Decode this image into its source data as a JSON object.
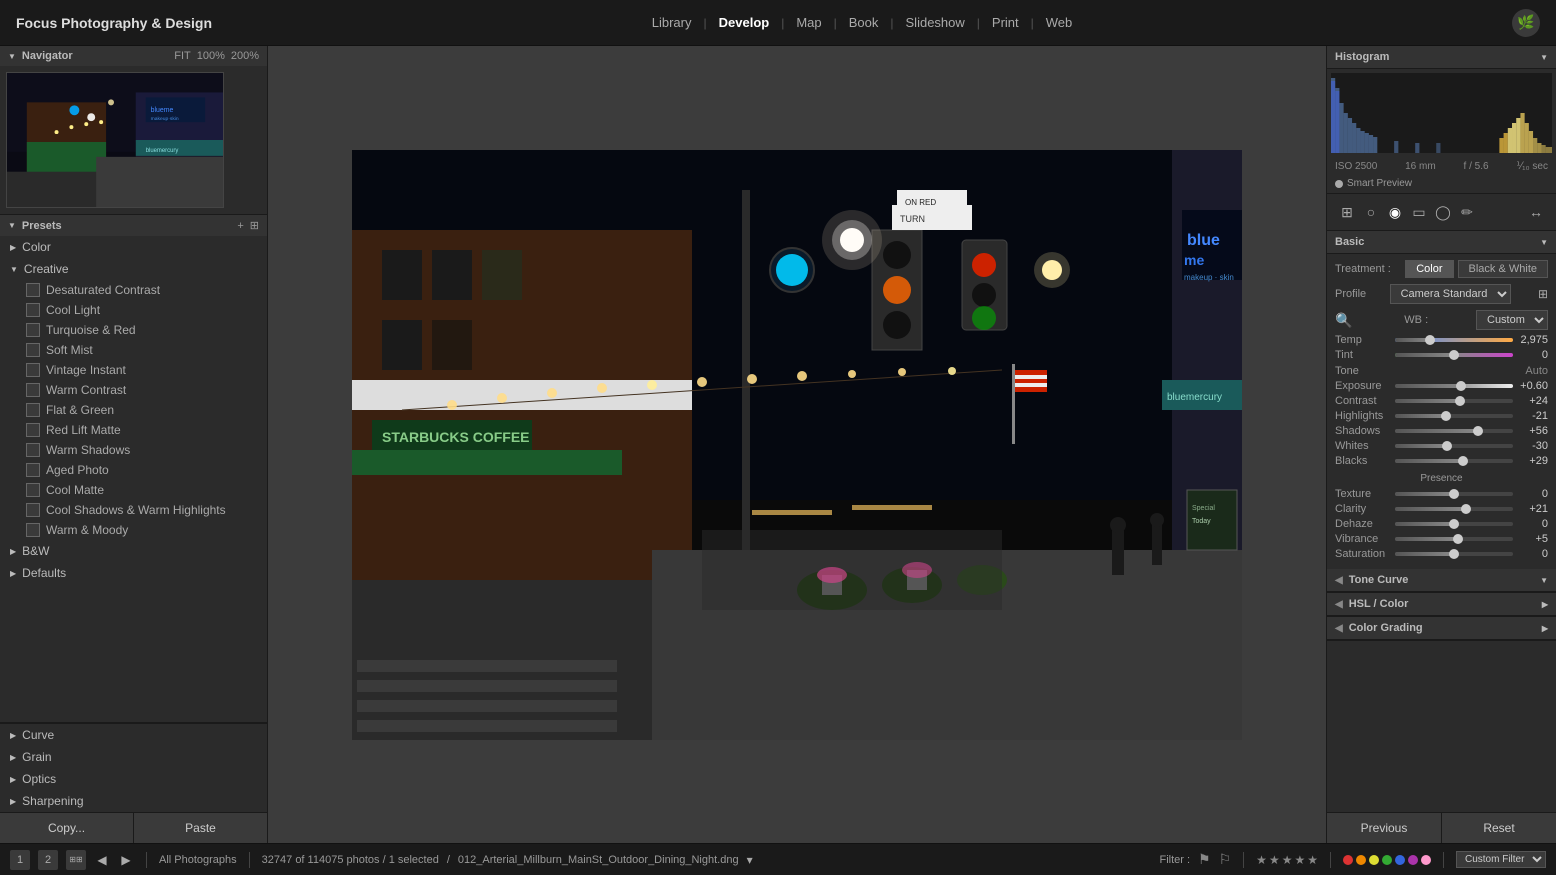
{
  "app": {
    "title": "Focus Photography & Design"
  },
  "nav": {
    "links": [
      "Library",
      "Develop",
      "Map",
      "Book",
      "Slideshow",
      "Print",
      "Web"
    ],
    "active": "Develop"
  },
  "navigator": {
    "label": "Navigator",
    "fit": "FIT",
    "zoom1": "100%",
    "zoom2": "200%"
  },
  "presets": {
    "label": "Presets",
    "sections": [
      {
        "name": "Color",
        "expanded": false,
        "items": []
      },
      {
        "name": "Creative",
        "expanded": true,
        "items": [
          "Desaturated Contrast",
          "Cool Light",
          "Turquoise & Red",
          "Soft Mist",
          "Vintage Instant",
          "Warm Contrast",
          "Flat & Green",
          "Red Lift Matte",
          "Warm Shadows",
          "Aged Photo",
          "Cool Matte",
          "Cool Shadows & Warm Highlights",
          "Warm & Moody"
        ]
      },
      {
        "name": "B&W",
        "expanded": false,
        "items": []
      },
      {
        "name": "Defaults",
        "expanded": false,
        "items": []
      }
    ]
  },
  "left_bottom": {
    "sections": [
      "Curve",
      "Grain",
      "Optics",
      "Sharpening"
    ]
  },
  "copy_paste": {
    "copy": "Copy...",
    "paste": "Paste"
  },
  "histogram": {
    "label": "Histogram"
  },
  "camera_info": {
    "iso": "ISO 2500",
    "focal": "16 mm",
    "aperture": "f / 5.6",
    "shutter": "⅟₁₀ sec"
  },
  "smart_preview": {
    "label": "Smart Preview"
  },
  "basic": {
    "label": "Basic",
    "treatment_label": "Treatment :",
    "color_btn": "Color",
    "bw_btn": "Black & White",
    "profile_label": "Profile",
    "profile_value": "Camera Standard",
    "wb_label": "WB :",
    "wb_value": "Custom",
    "temp_label": "Temp",
    "temp_value": "2,975",
    "tint_label": "Tint",
    "tint_value": "0",
    "tone_label": "Tone",
    "tone_auto": "Auto",
    "exposure_label": "Exposure",
    "exposure_value": "+0.60",
    "contrast_label": "Contrast",
    "contrast_value": "+24",
    "highlights_label": "Highlights",
    "highlights_value": "-21",
    "shadows_label": "Shadows",
    "shadows_value": "+56",
    "whites_label": "Whites",
    "whites_value": "-30",
    "blacks_label": "Blacks",
    "blacks_value": "+29",
    "presence_label": "Presence",
    "texture_label": "Texture",
    "texture_value": "0",
    "clarity_label": "Clarity",
    "clarity_value": "+21",
    "dehaze_label": "Dehaze",
    "dehaze_value": "0",
    "vibrance_label": "Vibrance",
    "vibrance_value": "+5",
    "saturation_label": "Saturation",
    "saturation_value": "0"
  },
  "tone_curve": {
    "label": "Tone Curve"
  },
  "hsl": {
    "label": "HSL / Color"
  },
  "color_grading": {
    "label": "Color Grading"
  },
  "prev_reset": {
    "previous": "Previous",
    "reset": "Reset"
  },
  "bottom_bar": {
    "view_btns": [
      "1",
      "2"
    ],
    "library_label": "All Photographs",
    "photo_info": "32747 of 114075 photos / 1 selected",
    "filename": "012_Arterial_Millburn_MainSt_Outdoor_Dining_Night.dng",
    "filter_label": "Filter :",
    "custom_filter": "Custom Filter"
  }
}
